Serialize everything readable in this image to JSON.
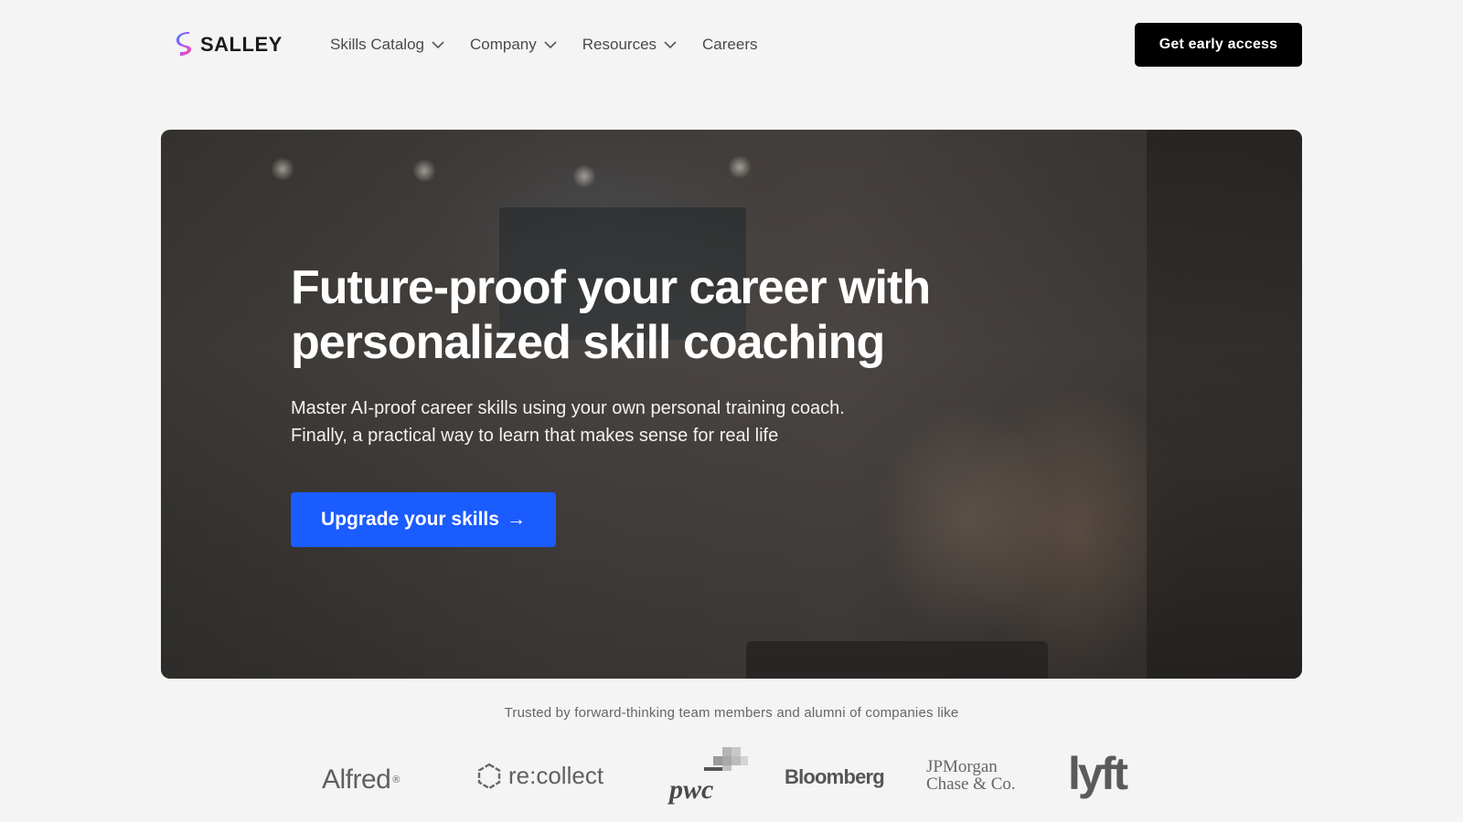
{
  "header": {
    "logo_text": "SALLEY",
    "nav": [
      {
        "label": "Skills Catalog",
        "has_dropdown": true
      },
      {
        "label": "Company",
        "has_dropdown": true
      },
      {
        "label": "Resources",
        "has_dropdown": true
      },
      {
        "label": "Careers",
        "has_dropdown": false
      }
    ],
    "cta_label": "Get early access"
  },
  "hero": {
    "title_line1": "Future-proof your career with",
    "title_line2": "personalized skill coaching",
    "subtitle_line1": "Master AI-proof career skills using your own personal training coach.",
    "subtitle_line2": "Finally, a practical way to learn that makes sense for real life",
    "cta_label": "Upgrade your skills",
    "cta_arrow": "→"
  },
  "trusted": {
    "text": "Trusted by forward-thinking team members and alumni of companies like",
    "logos": {
      "alfred": "Alfred",
      "alfred_mark": "®",
      "recollect": "re:collect",
      "pwc": "pwc",
      "bloomberg": "Bloomberg",
      "jpm_line1": "JPMorgan",
      "jpm_line2": "Chase & Co.",
      "lyft": "lyft"
    }
  },
  "colors": {
    "page_bg": "#f4f4f4",
    "primary_blue": "#1b5cff",
    "black_button": "#000000",
    "logo_gradient": [
      "#2f7cff",
      "#b44dff",
      "#ff4f9a"
    ]
  },
  "icons": {
    "logo": "salley-s-logo-icon",
    "dropdown": "chevron-down-icon",
    "arrow": "arrow-right-icon"
  }
}
